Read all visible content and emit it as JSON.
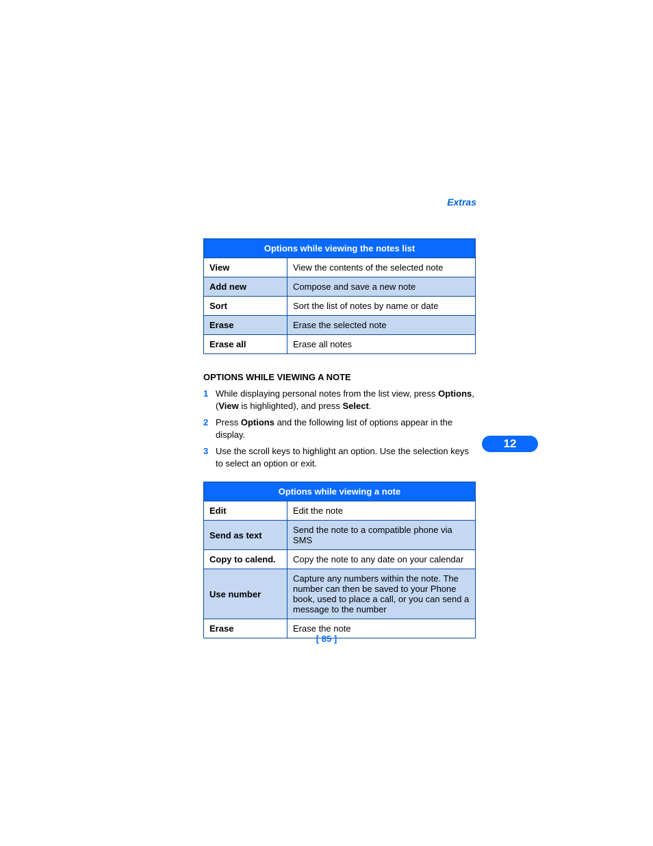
{
  "header": {
    "label": "Extras"
  },
  "table1": {
    "title": "Options while viewing the notes list",
    "rows": [
      {
        "name": "View",
        "desc": "View the contents of the selected note"
      },
      {
        "name": "Add new",
        "desc": "Compose and save a new note"
      },
      {
        "name": "Sort",
        "desc": "Sort the list of notes by name or date"
      },
      {
        "name": "Erase",
        "desc": "Erase the selected note"
      },
      {
        "name": "Erase all",
        "desc": "Erase all notes"
      }
    ]
  },
  "section_title": "OPTIONS WHILE VIEWING A NOTE",
  "steps": [
    {
      "num": "1",
      "pre": "While displaying personal notes from the list view, press ",
      "b1": "Options",
      "mid": ", (",
      "b2": "View",
      "mid2": " is highlighted), and press ",
      "b3": "Select",
      "post": "."
    },
    {
      "num": "2",
      "pre": "Press ",
      "b1": "Options",
      "mid": " and the following list of options appear in the display.",
      "b2": "",
      "mid2": "",
      "b3": "",
      "post": ""
    },
    {
      "num": "3",
      "pre": "Use the scroll keys to highlight an option. Use the selection keys to select an option or exit.",
      "b1": "",
      "mid": "",
      "b2": "",
      "mid2": "",
      "b3": "",
      "post": ""
    }
  ],
  "table2": {
    "title": "Options while viewing a note",
    "rows": [
      {
        "name": "Edit",
        "desc": "Edit the note"
      },
      {
        "name": "Send as text",
        "desc": "Send the note to a compatible phone via SMS"
      },
      {
        "name": "Copy to calend.",
        "desc": "Copy the note to any date on your calendar"
      },
      {
        "name": "Use number",
        "desc": "Capture any numbers within the note. The number can then be saved to your Phone book, used to place a call, or you can send a message to the number"
      },
      {
        "name": "Erase",
        "desc": "Erase the note"
      }
    ]
  },
  "chapter": "12",
  "page_number": "[ 85 ]"
}
